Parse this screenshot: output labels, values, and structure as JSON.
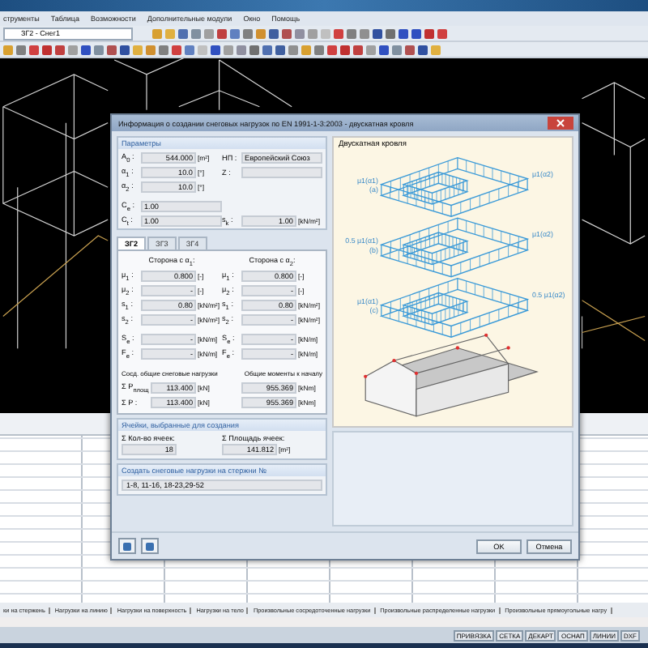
{
  "menu": [
    "струменты",
    "Таблица",
    "Возможности",
    "Дополнительные модули",
    "Окно",
    "Помощь"
  ],
  "toolbar": {
    "load_case": "ЗГ2 - Снег1"
  },
  "dialog": {
    "title": "Информация о создании снеговых нагрузок по EN 1991-1-3:2003 - двускатная кровля",
    "parameters": {
      "title": "Параметры",
      "rows": [
        {
          "left": {
            "label": "A$_{0}$ :",
            "value": "544.000",
            "unit": "[m²]"
          },
          "right": {
            "label": "НП :",
            "value": "Европейский Союз"
          }
        },
        {
          "left": {
            "label": "α$_{1}$ :",
            "value": "10.0",
            "unit": "[°]"
          },
          "right": {
            "label": "Z :"
          }
        },
        {
          "left": {
            "label": "α$_{2}$ :",
            "value": "10.0",
            "unit": "[°]"
          }
        },
        {
          "left": {
            "label": "C$_{e}$ :",
            "value": "1.00"
          }
        },
        {
          "left": {
            "label": "C$_{t}$ :",
            "value": "1.00"
          },
          "right": {
            "label": "s$_{k}$ :",
            "value": "1.00",
            "unit": "[kN/m²]"
          }
        }
      ]
    },
    "tabs": [
      {
        "label": "ЗГ2",
        "selected": true
      },
      {
        "label": "ЗГ3",
        "selected": false
      },
      {
        "label": "ЗГ4",
        "selected": false
      }
    ],
    "sides": [
      "Сторона с α$_{1}$:",
      "Сторона с α$_{2}$:"
    ],
    "side_rows": [
      [
        {
          "label": "μ$_{1}$ :",
          "value": "0.800",
          "unit": "[-]"
        },
        {
          "label": "μ$_{1}$ :",
          "value": "0.800",
          "unit": "[-]"
        }
      ],
      [
        {
          "label": "μ$_{2}$ :",
          "value": "-",
          "unit": "[-]"
        },
        {
          "label": "μ$_{2}$ :",
          "value": "-",
          "unit": "[-]"
        }
      ],
      [
        {
          "label": "s$_{1}$ :",
          "value": "0.80",
          "unit": "[kN/m²]"
        },
        {
          "label": "s$_{1}$ :",
          "value": "0.80",
          "unit": "[kN/m²]"
        }
      ],
      [
        {
          "label": "s$_{2}$ :",
          "value": "-",
          "unit": "[kN/m²]"
        },
        {
          "label": "s$_{2}$ :",
          "value": "-",
          "unit": "[kN/m²]"
        }
      ],
      [
        {
          "label": "S$_{e}$ :",
          "value": "-",
          "unit": "[kN/m]"
        },
        {
          "label": "S$_{e}$ :",
          "value": "-",
          "unit": "[kN/m]"
        }
      ],
      [
        {
          "label": "F$_{e}$ :",
          "value": "-",
          "unit": "[kN/m]"
        },
        {
          "label": "F$_{e}$ :",
          "value": "-",
          "unit": "[kN/m]"
        }
      ]
    ],
    "totals_headers": [
      "Сосд. общие снеговые нагрузки",
      "Общие моменты к началу"
    ],
    "totals": [
      {
        "label": "Σ P$_{площ}$ :",
        "force": "113.400",
        "force_unit": "[kN]",
        "moment": "955.369",
        "moment_unit": "[kNm]"
      },
      {
        "label": "Σ P :",
        "force": "113.400",
        "force_unit": "[kN]",
        "moment": "955.369",
        "moment_unit": "[kNm]"
      }
    ],
    "cells": {
      "title": "Ячейки, выбранные для создания",
      "items": [
        {
          "label": "Σ Кол-во ячеек:",
          "value": "18"
        },
        {
          "label": "Σ Площадь ячеек:",
          "value": "141.812",
          "unit": "[m²]"
        }
      ]
    },
    "members": {
      "title": "Создать снеговые нагрузки на стержни №",
      "value": "1-8, 11-16, 18-23,29-52"
    },
    "drawing": {
      "title": "Двускатная кровля",
      "frames": [
        {
          "left": "μ1(α1)",
          "mark": "(a)",
          "right": "μ1(α2)"
        },
        {
          "left": "0.5 μ1(α1)",
          "mark": "(b)",
          "right": "μ1(α2)"
        },
        {
          "left": "μ1(α1)",
          "mark": "(c)",
          "right": "0.5 μ1(α2)"
        }
      ]
    },
    "buttons": [
      "OK",
      "Отмена"
    ]
  },
  "bottom_tabs": [
    "ки на стержень",
    "Нагрузки на линию",
    "Нагрузки на поверхность",
    "Нагрузки на тело",
    "Произвольные сосредоточенные нагрузки",
    "Произвольные распределенные нагрузки",
    "Произвольные прямоугольные нагру"
  ],
  "status_toggles": [
    "ПРИВЯЗКА",
    "СЕТКА",
    "ДЕКАРТ",
    "ОСНАП",
    "ЛИНИИ",
    "DXF"
  ]
}
